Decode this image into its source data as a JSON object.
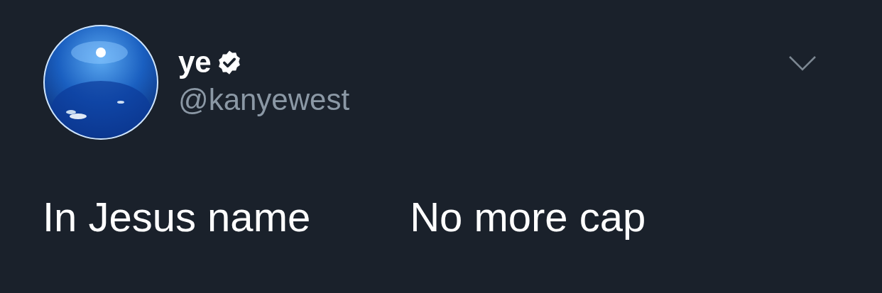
{
  "author": {
    "name": "ye",
    "verified": true,
    "handle": "@kanyewest"
  },
  "tweet": {
    "segments": [
      "In Jesus name",
      "No more cap"
    ]
  }
}
